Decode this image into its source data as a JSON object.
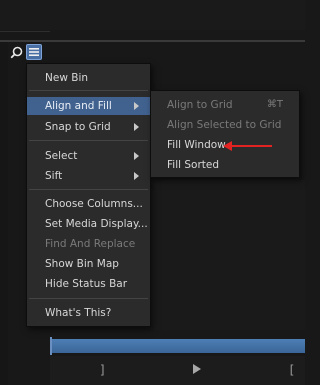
{
  "menu": {
    "items": [
      {
        "label": "New Bin"
      },
      {
        "label": "Align and Fill"
      },
      {
        "label": "Snap to Grid"
      },
      {
        "label": "Select"
      },
      {
        "label": "Sift"
      },
      {
        "label": "Choose Columns..."
      },
      {
        "label": "Set Media Display..."
      },
      {
        "label": "Find And Replace"
      },
      {
        "label": "Show Bin Map"
      },
      {
        "label": "Hide Status Bar"
      },
      {
        "label": "What's This?"
      }
    ]
  },
  "submenu": {
    "items": [
      {
        "label": "Align to Grid",
        "shortcut": "⌘T"
      },
      {
        "label": "Align Selected to Grid"
      },
      {
        "label": "Fill Window"
      },
      {
        "label": "Fill Sorted"
      }
    ]
  },
  "transport": {
    "mark_out": "]",
    "mark_in": "[",
    "play_icon": "play-icon"
  },
  "colors": {
    "highlight": "#41628f",
    "menu_bg": "#2b2b2b",
    "annotation": "#e32222",
    "timeline": "#4d7fb4"
  }
}
